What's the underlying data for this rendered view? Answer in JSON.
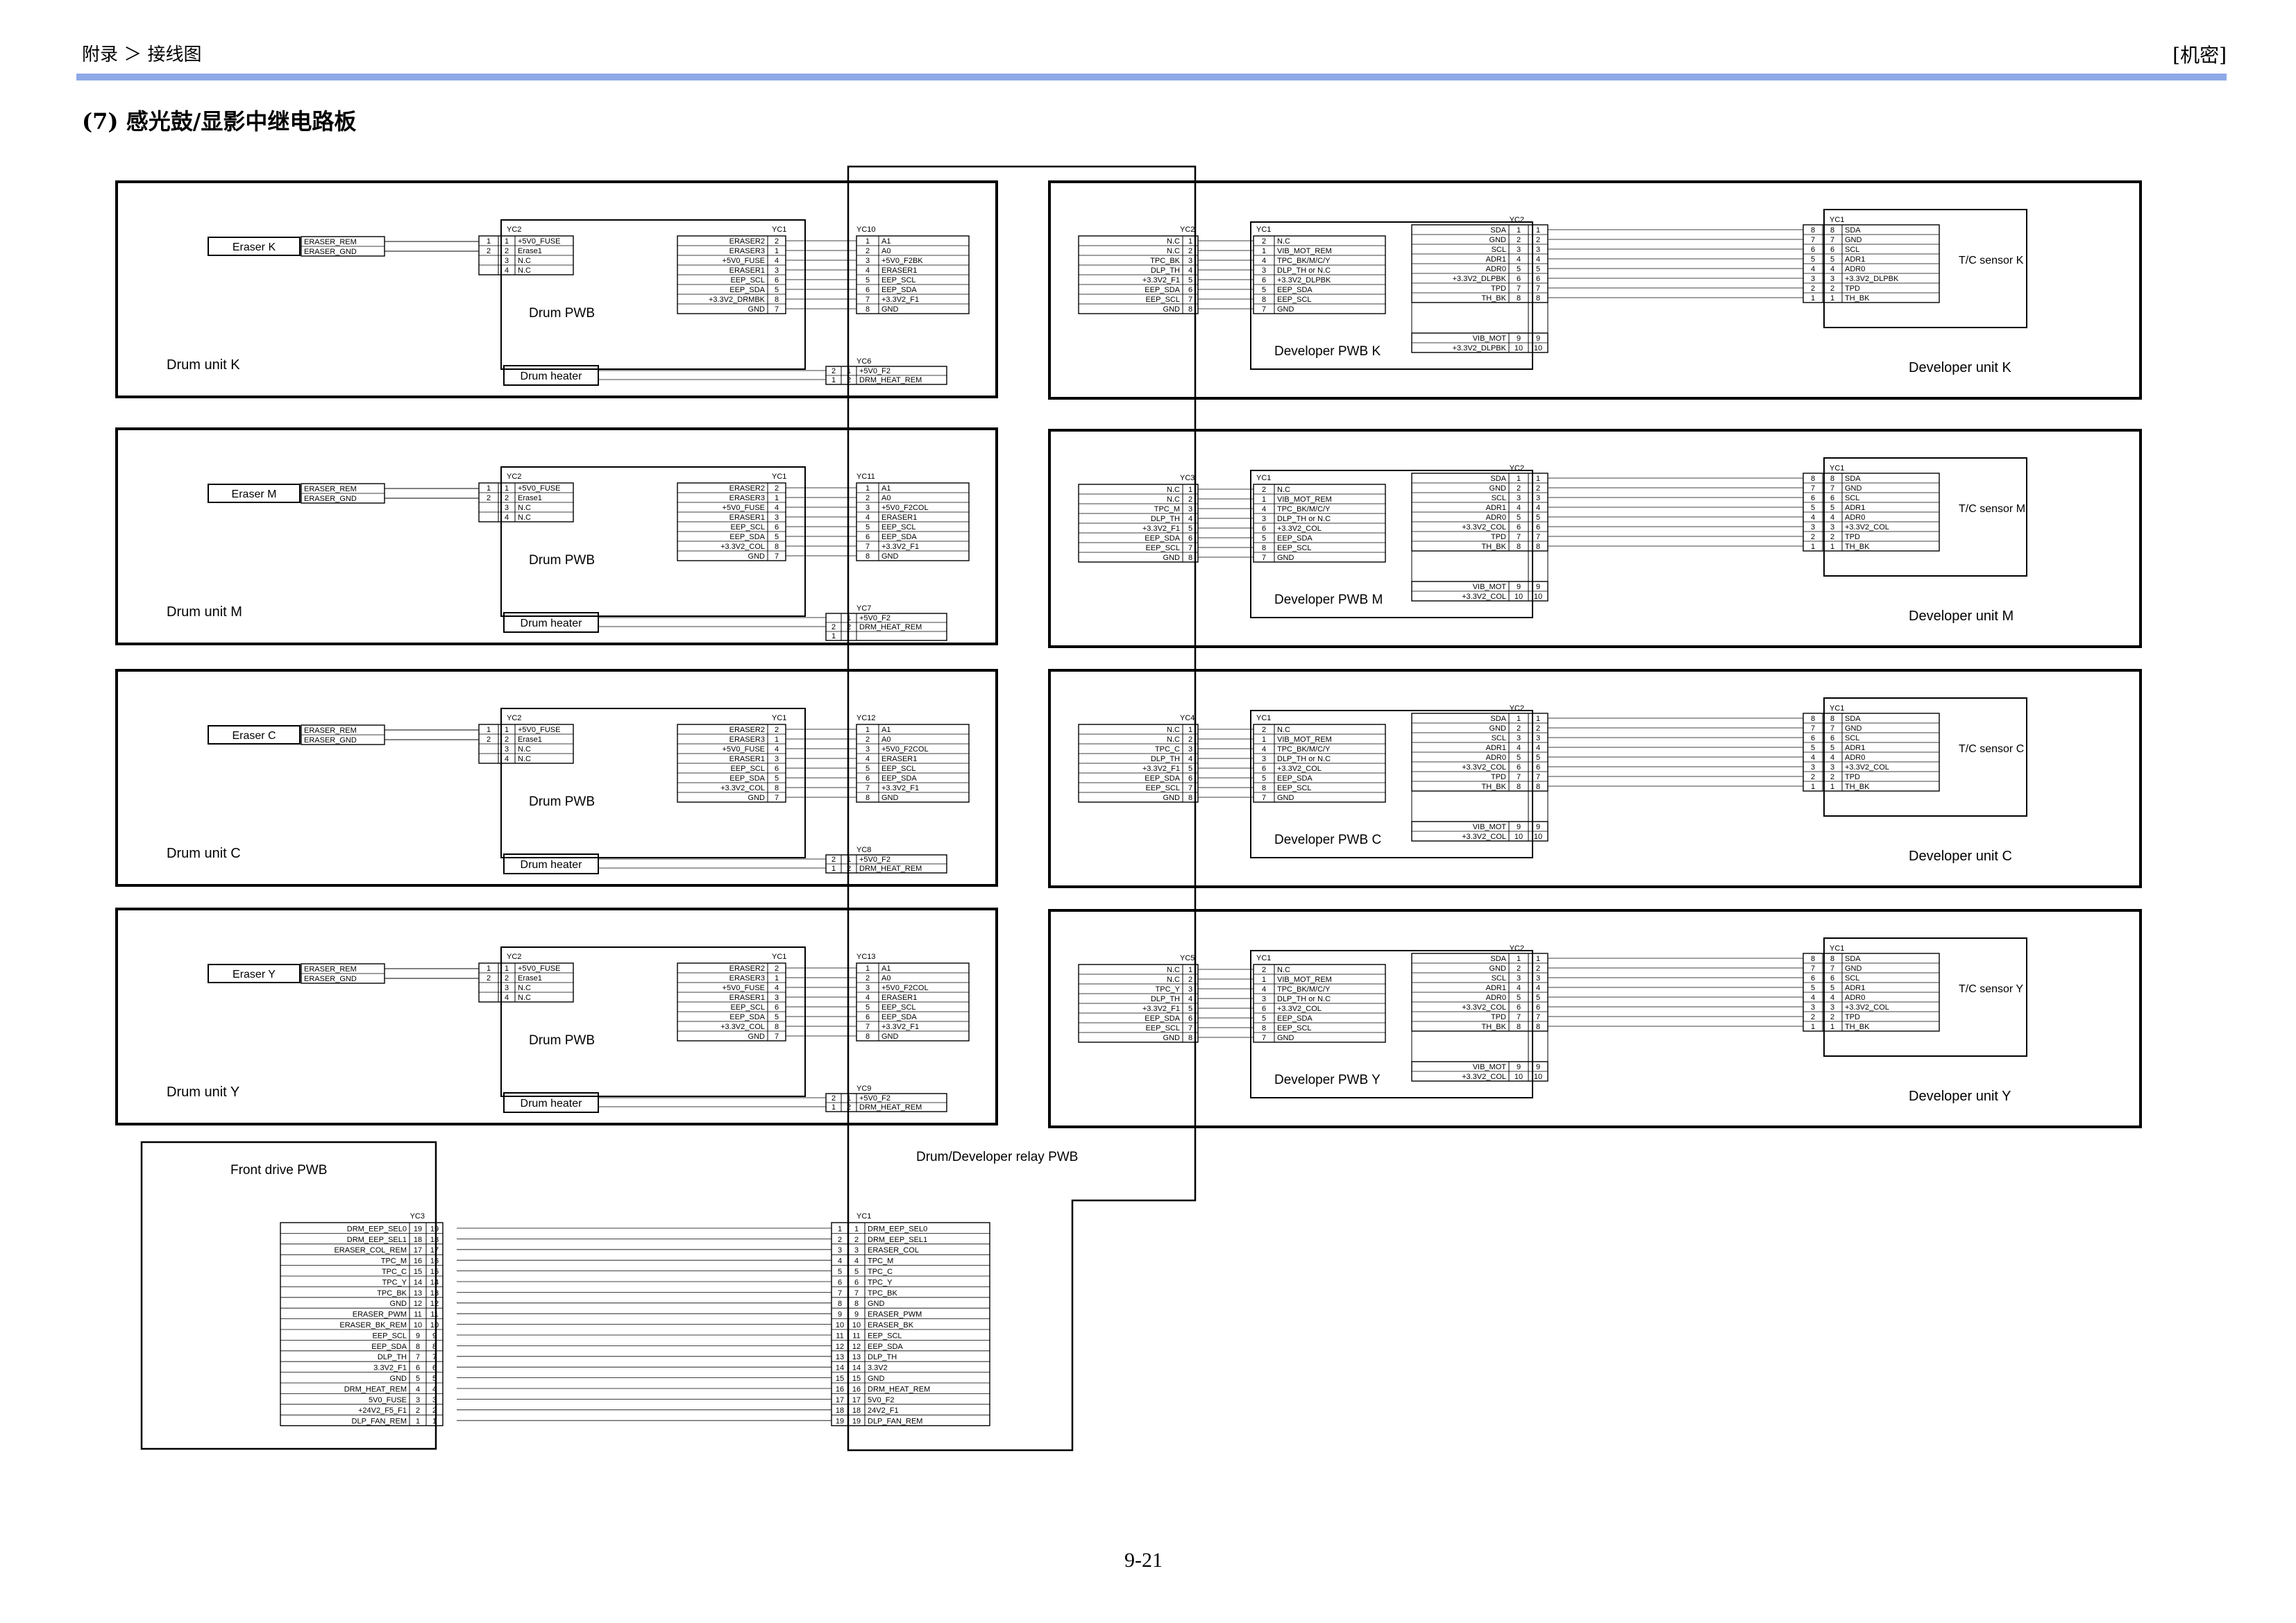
{
  "header": {
    "breadcrumb": "附录 ＞ 接线图",
    "confidential": "[机密]"
  },
  "section_title": "(7)  感光鼓/显影中继电路板",
  "page_number": "9-21",
  "relay_pwb_label": "Drum/Developer relay PWB",
  "drum_units": [
    {
      "unit": "Drum unit K",
      "eraser": "Eraser K",
      "pwb": "Drum PWB",
      "heater": "Drum heater",
      "eraser_wires": [
        "ERASER_REM",
        "ERASER_GND"
      ],
      "yc2": "YC2",
      "yc2_pins": [
        [
          "1",
          "1",
          "+5V0_FUSE"
        ],
        [
          "2",
          "2",
          "Erase1"
        ],
        [
          "",
          "3",
          "N.C"
        ],
        [
          "",
          "4",
          "N.C"
        ]
      ],
      "yc1": "YC1",
      "yc1_rows": [
        [
          "ERASER2",
          "2"
        ],
        [
          "ERASER3",
          "1"
        ],
        [
          "+5V0_FUSE",
          "4"
        ],
        [
          "ERASER1",
          "3"
        ],
        [
          "EEP_SCL",
          "6"
        ],
        [
          "EEP_SDA",
          "5"
        ],
        [
          "+3.3V2_DRMBK",
          "8"
        ],
        [
          "GND",
          "7"
        ]
      ],
      "relay_conn": "YC10",
      "relay_rows": [
        [
          "1",
          "A1"
        ],
        [
          "2",
          "A0"
        ],
        [
          "3",
          "+5V0_F2BK"
        ],
        [
          "4",
          "ERASER1"
        ],
        [
          "5",
          "EEP_SCL"
        ],
        [
          "6",
          "EEP_SDA"
        ],
        [
          "7",
          "+3.3V2_F1"
        ],
        [
          "8",
          "GND"
        ]
      ],
      "heater_conn": "YC6",
      "heater_rows": [
        [
          "2",
          "1",
          "+5V0_F2"
        ],
        [
          "1",
          "2",
          "DRM_HEAT_REM"
        ]
      ]
    },
    {
      "unit": "Drum unit M",
      "eraser": "Eraser M",
      "pwb": "Drum PWB",
      "heater": "Drum heater",
      "eraser_wires": [
        "ERASER_REM",
        "ERASER_GND"
      ],
      "yc2": "YC2",
      "yc2_pins": [
        [
          "1",
          "1",
          "+5V0_FUSE"
        ],
        [
          "2",
          "2",
          "Erase1"
        ],
        [
          "",
          "3",
          "N.C"
        ],
        [
          "",
          "4",
          "N.C"
        ]
      ],
      "yc1": "YC1",
      "yc1_rows": [
        [
          "ERASER2",
          "2"
        ],
        [
          "ERASER3",
          "1"
        ],
        [
          "+5V0_FUSE",
          "4"
        ],
        [
          "ERASER1",
          "3"
        ],
        [
          "EEP_SCL",
          "6"
        ],
        [
          "EEP_SDA",
          "5"
        ],
        [
          "+3.3V2_COL",
          "8"
        ],
        [
          "GND",
          "7"
        ]
      ],
      "relay_conn": "YC11",
      "relay_rows": [
        [
          "1",
          "A1"
        ],
        [
          "2",
          "A0"
        ],
        [
          "3",
          "+5V0_F2COL"
        ],
        [
          "4",
          "ERASER1"
        ],
        [
          "5",
          "EEP_SCL"
        ],
        [
          "6",
          "EEP_SDA"
        ],
        [
          "7",
          "+3.3V2_F1"
        ],
        [
          "8",
          "GND"
        ]
      ],
      "heater_conn": "YC7",
      "heater_rows": [
        [
          "",
          "1",
          "+5V0_F2"
        ],
        [
          "2",
          "2",
          "DRM_HEAT_REM"
        ],
        [
          "1",
          "",
          ""
        ]
      ]
    },
    {
      "unit": "Drum unit C",
      "eraser": "Eraser C",
      "pwb": "Drum PWB",
      "heater": "Drum heater",
      "eraser_wires": [
        "ERASER_REM",
        "ERASER_GND"
      ],
      "yc2": "YC2",
      "yc2_pins": [
        [
          "1",
          "1",
          "+5V0_FUSE"
        ],
        [
          "2",
          "2",
          "Erase1"
        ],
        [
          "",
          "3",
          "N.C"
        ],
        [
          "",
          "4",
          "N.C"
        ]
      ],
      "yc1": "YC1",
      "yc1_rows": [
        [
          "ERASER2",
          "2"
        ],
        [
          "ERASER3",
          "1"
        ],
        [
          "+5V0_FUSE",
          "4"
        ],
        [
          "ERASER1",
          "3"
        ],
        [
          "EEP_SCL",
          "6"
        ],
        [
          "EEP_SDA",
          "5"
        ],
        [
          "+3.3V2_COL",
          "8"
        ],
        [
          "GND",
          "7"
        ]
      ],
      "relay_conn": "YC12",
      "relay_rows": [
        [
          "1",
          "A1"
        ],
        [
          "2",
          "A0"
        ],
        [
          "3",
          "+5V0_F2COL"
        ],
        [
          "4",
          "ERASER1"
        ],
        [
          "5",
          "EEP_SCL"
        ],
        [
          "6",
          "EEP_SDA"
        ],
        [
          "7",
          "+3.3V2_F1"
        ],
        [
          "8",
          "GND"
        ]
      ],
      "heater_conn": "YC8",
      "heater_rows": [
        [
          "2",
          "1",
          "+5V0_F2"
        ],
        [
          "1",
          "2",
          "DRM_HEAT_REM"
        ]
      ]
    },
    {
      "unit": "Drum unit Y",
      "eraser": "Eraser Y",
      "pwb": "Drum PWB",
      "heater": "Drum heater",
      "eraser_wires": [
        "ERASER_REM",
        "ERASER_GND"
      ],
      "yc2": "YC2",
      "yc2_pins": [
        [
          "1",
          "1",
          "+5V0_FUSE"
        ],
        [
          "2",
          "2",
          "Erase1"
        ],
        [
          "",
          "3",
          "N.C"
        ],
        [
          "",
          "4",
          "N.C"
        ]
      ],
      "yc1": "YC1",
      "yc1_rows": [
        [
          "ERASER2",
          "2"
        ],
        [
          "ERASER3",
          "1"
        ],
        [
          "+5V0_FUSE",
          "4"
        ],
        [
          "ERASER1",
          "3"
        ],
        [
          "EEP_SCL",
          "6"
        ],
        [
          "EEP_SDA",
          "5"
        ],
        [
          "+3.3V2_COL",
          "8"
        ],
        [
          "GND",
          "7"
        ]
      ],
      "relay_conn": "YC13",
      "relay_rows": [
        [
          "1",
          "A1"
        ],
        [
          "2",
          "A0"
        ],
        [
          "3",
          "+5V0_F2COL"
        ],
        [
          "4",
          "ERASER1"
        ],
        [
          "5",
          "EEP_SCL"
        ],
        [
          "6",
          "EEP_SDA"
        ],
        [
          "7",
          "+3.3V2_F1"
        ],
        [
          "8",
          "GND"
        ]
      ],
      "heater_conn": "YC9",
      "heater_rows": [
        [
          "2",
          "1",
          "+5V0_F2"
        ],
        [
          "1",
          "2",
          "DRM_HEAT_REM"
        ]
      ]
    }
  ],
  "developer_units": [
    {
      "unit": "Developer unit K",
      "pwb": "Developer PWB K",
      "sensor": "T/C sensor K",
      "relay_conn": "YC2",
      "relay_rows": [
        [
          "N.C",
          "1"
        ],
        [
          "N.C",
          "2"
        ],
        [
          "TPC_BK",
          "3"
        ],
        [
          "DLP_TH",
          "4"
        ],
        [
          "+3.3V2_F1",
          "5"
        ],
        [
          "EEP_SDA",
          "6"
        ],
        [
          "EEP_SCL",
          "7"
        ],
        [
          "GND",
          "8"
        ]
      ],
      "pwb_conn": "YC1",
      "pwb_rows": [
        [
          "2",
          "N.C"
        ],
        [
          "1",
          "VIB_MOT_REM"
        ],
        [
          "4",
          "TPC_BK/M/C/Y"
        ],
        [
          "3",
          "DLP_TH or N.C"
        ],
        [
          "6",
          "+3.3V2_DLPBK"
        ],
        [
          "5",
          "EEP_SDA"
        ],
        [
          "8",
          "EEP_SCL"
        ],
        [
          "7",
          "GND"
        ]
      ],
      "yc2": "YC2",
      "yc2_rows": [
        [
          "SDA",
          "1",
          "1"
        ],
        [
          "GND",
          "2",
          "2"
        ],
        [
          "SCL",
          "3",
          "3"
        ],
        [
          "ADR1",
          "4",
          "4"
        ],
        [
          "ADR0",
          "5",
          "5"
        ],
        [
          "+3.3V2_DLPBK",
          "6",
          "6"
        ],
        [
          "TPD",
          "7",
          "7"
        ],
        [
          "TH_BK",
          "8",
          "8"
        ]
      ],
      "yc2_extra": [
        [
          "VIB_MOT",
          "9",
          "9"
        ],
        [
          "+3.3V2_DLPBK",
          "10",
          "10"
        ]
      ],
      "sensor_conn": "YC1",
      "sensor_rows": [
        [
          "8",
          "8",
          "SDA"
        ],
        [
          "7",
          "7",
          "GND"
        ],
        [
          "6",
          "6",
          "SCL"
        ],
        [
          "5",
          "5",
          "ADR1"
        ],
        [
          "4",
          "4",
          "ADR0"
        ],
        [
          "3",
          "3",
          "+3.3V2_DLPBK"
        ],
        [
          "2",
          "2",
          "TPD"
        ],
        [
          "1",
          "1",
          "TH_BK"
        ]
      ]
    },
    {
      "unit": "Developer unit M",
      "pwb": "Developer PWB M",
      "sensor": "T/C sensor M",
      "relay_conn": "YC3",
      "relay_rows": [
        [
          "N.C",
          "1"
        ],
        [
          "N.C",
          "2"
        ],
        [
          "TPC_M",
          "3"
        ],
        [
          "DLP_TH",
          "4"
        ],
        [
          "+3.3V2_F1",
          "5"
        ],
        [
          "EEP_SDA",
          "6"
        ],
        [
          "EEP_SCL",
          "7"
        ],
        [
          "GND",
          "8"
        ]
      ],
      "pwb_conn": "YC1",
      "pwb_rows": [
        [
          "2",
          "N.C"
        ],
        [
          "1",
          "VIB_MOT_REM"
        ],
        [
          "4",
          "TPC_BK/M/C/Y"
        ],
        [
          "3",
          "DLP_TH or N.C"
        ],
        [
          "6",
          "+3.3V2_COL"
        ],
        [
          "5",
          "EEP_SDA"
        ],
        [
          "8",
          "EEP_SCL"
        ],
        [
          "7",
          "GND"
        ]
      ],
      "yc2": "YC2",
      "yc2_rows": [
        [
          "SDA",
          "1",
          "1"
        ],
        [
          "GND",
          "2",
          "2"
        ],
        [
          "SCL",
          "3",
          "3"
        ],
        [
          "ADR1",
          "4",
          "4"
        ],
        [
          "ADR0",
          "5",
          "5"
        ],
        [
          "+3.3V2_COL",
          "6",
          "6"
        ],
        [
          "TPD",
          "7",
          "7"
        ],
        [
          "TH_BK",
          "8",
          "8"
        ]
      ],
      "yc2_extra": [
        [
          "VIB_MOT",
          "9",
          "9"
        ],
        [
          "+3.3V2_COL",
          "10",
          "10"
        ]
      ],
      "sensor_conn": "YC1",
      "sensor_rows": [
        [
          "8",
          "8",
          "SDA"
        ],
        [
          "7",
          "7",
          "GND"
        ],
        [
          "6",
          "6",
          "SCL"
        ],
        [
          "5",
          "5",
          "ADR1"
        ],
        [
          "4",
          "4",
          "ADR0"
        ],
        [
          "3",
          "3",
          "+3.3V2_COL"
        ],
        [
          "2",
          "2",
          "TPD"
        ],
        [
          "1",
          "1",
          "TH_BK"
        ]
      ]
    },
    {
      "unit": "Developer unit C",
      "pwb": "Developer PWB C",
      "sensor": "T/C sensor C",
      "relay_conn": "YC4",
      "relay_rows": [
        [
          "N.C",
          "1"
        ],
        [
          "N.C",
          "2"
        ],
        [
          "TPC_C",
          "3"
        ],
        [
          "DLP_TH",
          "4"
        ],
        [
          "+3.3V2_F1",
          "5"
        ],
        [
          "EEP_SDA",
          "6"
        ],
        [
          "EEP_SCL",
          "7"
        ],
        [
          "GND",
          "8"
        ]
      ],
      "pwb_conn": "YC1",
      "pwb_rows": [
        [
          "2",
          "N.C"
        ],
        [
          "1",
          "VIB_MOT_REM"
        ],
        [
          "4",
          "TPC_BK/M/C/Y"
        ],
        [
          "3",
          "DLP_TH or N.C"
        ],
        [
          "6",
          "+3.3V2_COL"
        ],
        [
          "5",
          "EEP_SDA"
        ],
        [
          "8",
          "EEP_SCL"
        ],
        [
          "7",
          "GND"
        ]
      ],
      "yc2": "YC2",
      "yc2_rows": [
        [
          "SDA",
          "1",
          "1"
        ],
        [
          "GND",
          "2",
          "2"
        ],
        [
          "SCL",
          "3",
          "3"
        ],
        [
          "ADR1",
          "4",
          "4"
        ],
        [
          "ADR0",
          "5",
          "5"
        ],
        [
          "+3.3V2_COL",
          "6",
          "6"
        ],
        [
          "TPD",
          "7",
          "7"
        ],
        [
          "TH_BK",
          "8",
          "8"
        ]
      ],
      "yc2_extra": [
        [
          "VIB_MOT",
          "9",
          "9"
        ],
        [
          "+3.3V2_COL",
          "10",
          "10"
        ]
      ],
      "sensor_conn": "YC1",
      "sensor_rows": [
        [
          "8",
          "8",
          "SDA"
        ],
        [
          "7",
          "7",
          "GND"
        ],
        [
          "6",
          "6",
          "SCL"
        ],
        [
          "5",
          "5",
          "ADR1"
        ],
        [
          "4",
          "4",
          "ADR0"
        ],
        [
          "3",
          "3",
          "+3.3V2_COL"
        ],
        [
          "2",
          "2",
          "TPD"
        ],
        [
          "1",
          "1",
          "TH_BK"
        ]
      ]
    },
    {
      "unit": "Developer unit Y",
      "pwb": "Developer PWB Y",
      "sensor": "T/C sensor Y",
      "relay_conn": "YC5",
      "relay_rows": [
        [
          "N.C",
          "1"
        ],
        [
          "N.C",
          "2"
        ],
        [
          "TPC_Y",
          "3"
        ],
        [
          "DLP_TH",
          "4"
        ],
        [
          "+3.3V2_F1",
          "5"
        ],
        [
          "EEP_SDA",
          "6"
        ],
        [
          "EEP_SCL",
          "7"
        ],
        [
          "GND",
          "8"
        ]
      ],
      "pwb_conn": "YC1",
      "pwb_rows": [
        [
          "2",
          "N.C"
        ],
        [
          "1",
          "VIB_MOT_REM"
        ],
        [
          "4",
          "TPC_BK/M/C/Y"
        ],
        [
          "3",
          "DLP_TH or N.C"
        ],
        [
          "6",
          "+3.3V2_COL"
        ],
        [
          "5",
          "EEP_SDA"
        ],
        [
          "8",
          "EEP_SCL"
        ],
        [
          "7",
          "GND"
        ]
      ],
      "yc2": "YC2",
      "yc2_rows": [
        [
          "SDA",
          "1",
          "1"
        ],
        [
          "GND",
          "2",
          "2"
        ],
        [
          "SCL",
          "3",
          "3"
        ],
        [
          "ADR1",
          "4",
          "4"
        ],
        [
          "ADR0",
          "5",
          "5"
        ],
        [
          "+3.3V2_COL",
          "6",
          "6"
        ],
        [
          "TPD",
          "7",
          "7"
        ],
        [
          "TH_BK",
          "8",
          "8"
        ]
      ],
      "yc2_extra": [
        [
          "VIB_MOT",
          "9",
          "9"
        ],
        [
          "+3.3V2_COL",
          "10",
          "10"
        ]
      ],
      "sensor_conn": "YC1",
      "sensor_rows": [
        [
          "8",
          "8",
          "SDA"
        ],
        [
          "7",
          "7",
          "GND"
        ],
        [
          "6",
          "6",
          "SCL"
        ],
        [
          "5",
          "5",
          "ADR1"
        ],
        [
          "4",
          "4",
          "ADR0"
        ],
        [
          "3",
          "3",
          "+3.3V2_COL"
        ],
        [
          "2",
          "2",
          "TPD"
        ],
        [
          "1",
          "1",
          "TH_BK"
        ]
      ]
    }
  ],
  "front_drive": {
    "label": "Front drive PWB",
    "conn": "YC3",
    "rows": [
      [
        "DRM_EEP_SEL0",
        "19",
        "19"
      ],
      [
        "DRM_EEP_SEL1",
        "18",
        "18"
      ],
      [
        "ERASER_COL_REM",
        "17",
        "17"
      ],
      [
        "TPC_M",
        "16",
        "16"
      ],
      [
        "TPC_C",
        "15",
        "15"
      ],
      [
        "TPC_Y",
        "14",
        "14"
      ],
      [
        "TPC_BK",
        "13",
        "13"
      ],
      [
        "GND",
        "12",
        "12"
      ],
      [
        "ERASER_PWM",
        "11",
        "11"
      ],
      [
        "ERASER_BK_REM",
        "10",
        "10"
      ],
      [
        "EEP_SCL",
        "9",
        "9"
      ],
      [
        "EEP_SDA",
        "8",
        "8"
      ],
      [
        "DLP_TH",
        "7",
        "7"
      ],
      [
        "3.3V2_F1",
        "6",
        "6"
      ],
      [
        "GND",
        "5",
        "5"
      ],
      [
        "DRM_HEAT_REM",
        "4",
        "4"
      ],
      [
        "5V0_FUSE",
        "3",
        "3"
      ],
      [
        "+24V2_F5_F1",
        "2",
        "2"
      ],
      [
        "DLP_FAN_REM",
        "1",
        "1"
      ]
    ],
    "relay_conn": "YC1",
    "relay_rows": [
      [
        "1",
        "1",
        "DRM_EEP_SEL0"
      ],
      [
        "2",
        "2",
        "DRM_EEP_SEL1"
      ],
      [
        "3",
        "3",
        "ERASER_COL"
      ],
      [
        "4",
        "4",
        "TPC_M"
      ],
      [
        "5",
        "5",
        "TPC_C"
      ],
      [
        "6",
        "6",
        "TPC_Y"
      ],
      [
        "7",
        "7",
        "TPC_BK"
      ],
      [
        "8",
        "8",
        "GND"
      ],
      [
        "9",
        "9",
        "ERASER_PWM"
      ],
      [
        "10",
        "10",
        "ERASER_BK"
      ],
      [
        "11",
        "11",
        "EEP_SCL"
      ],
      [
        "12",
        "12",
        "EEP_SDA"
      ],
      [
        "13",
        "13",
        "DLP_TH"
      ],
      [
        "14",
        "14",
        "3.3V2"
      ],
      [
        "15",
        "15",
        "GND"
      ],
      [
        "16",
        "16",
        "DRM_HEAT_REM"
      ],
      [
        "17",
        "17",
        "5V0_F2"
      ],
      [
        "18",
        "18",
        "24V2_F1"
      ],
      [
        "19",
        "19",
        "DLP_FAN_REM"
      ]
    ]
  }
}
